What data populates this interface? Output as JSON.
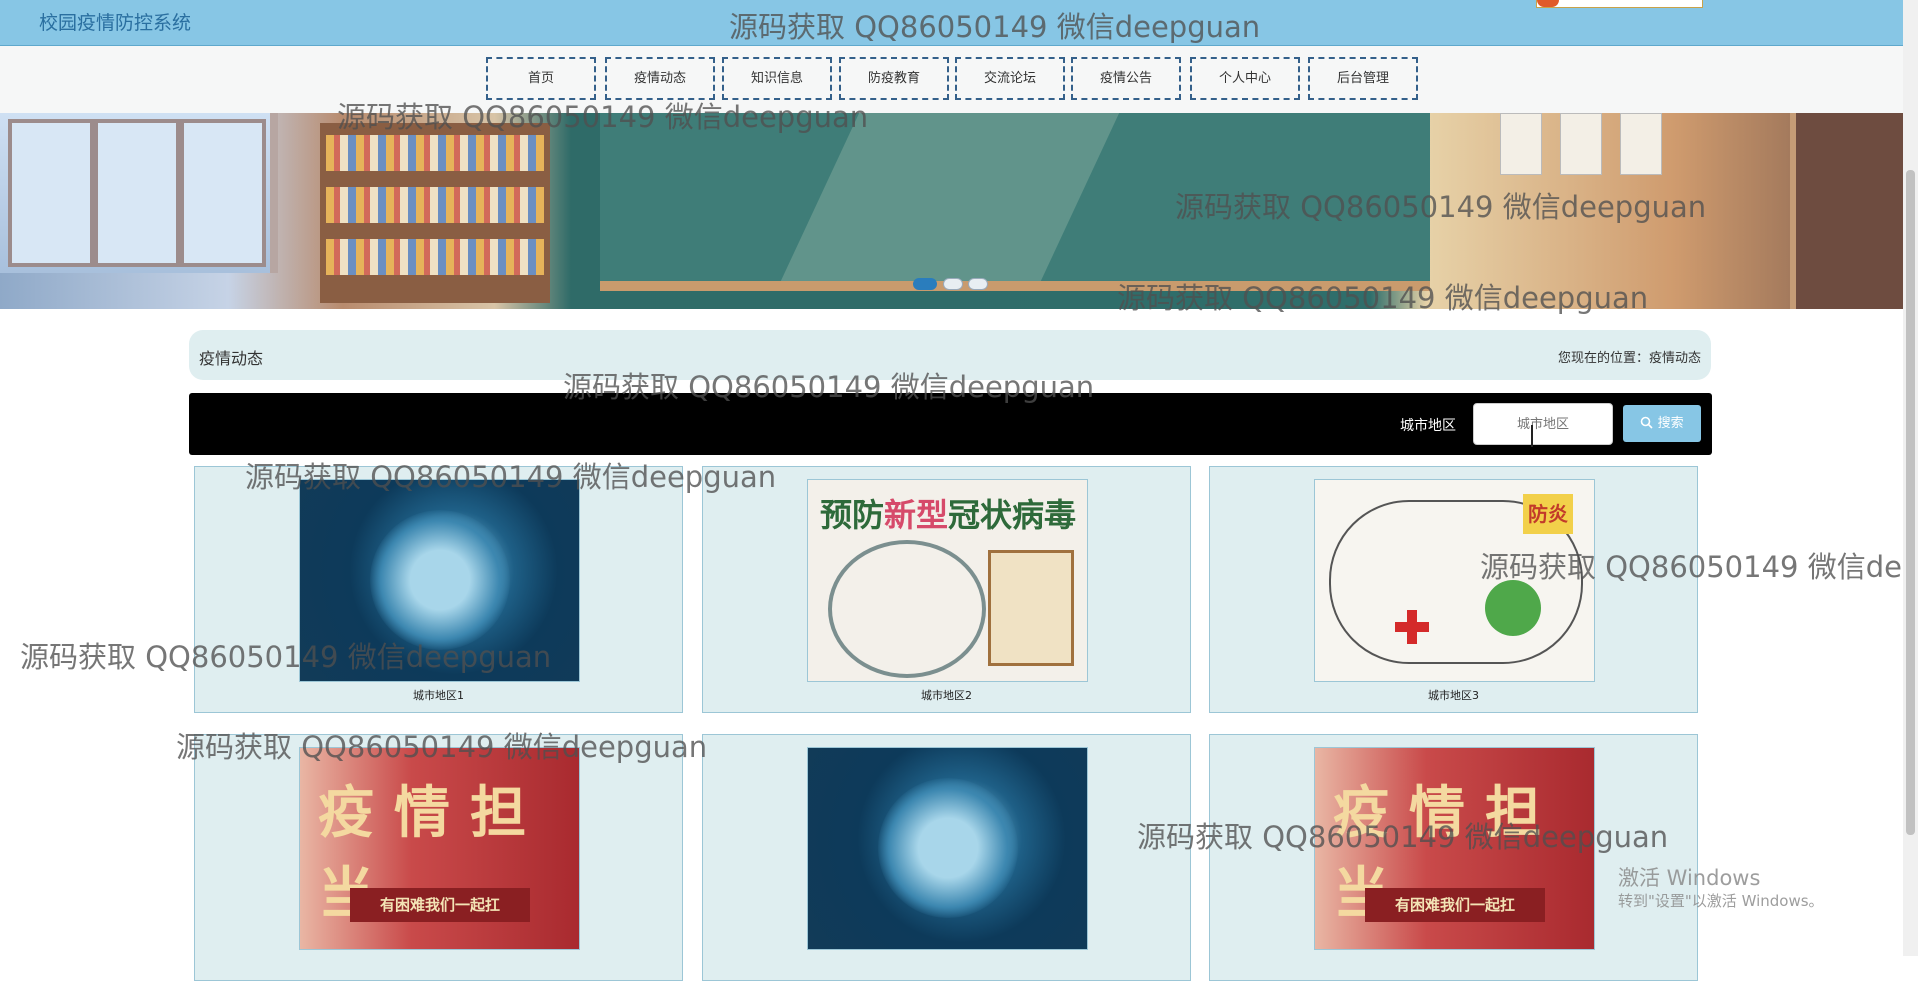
{
  "header": {
    "site_title": "校园疫情防控系统"
  },
  "nav": {
    "items": [
      {
        "label": "首页"
      },
      {
        "label": "疫情动态"
      },
      {
        "label": "知识信息"
      },
      {
        "label": "防疫教育"
      },
      {
        "label": "交流论坛"
      },
      {
        "label": "疫情公告"
      },
      {
        "label": "个人中心"
      },
      {
        "label": "后台管理"
      }
    ]
  },
  "carousel": {
    "slide_count": 3,
    "active_slide": 1
  },
  "section": {
    "title": "疫情动态",
    "location_text": "您现在的位置：疫情动态"
  },
  "search": {
    "label": "城市地区",
    "placeholder": "城市地区",
    "button_label": "搜索"
  },
  "cards": [
    {
      "caption": "城市地区1",
      "image": "virus"
    },
    {
      "caption": "城市地区2",
      "image": "poster"
    },
    {
      "caption": "城市地区3",
      "image": "drawing"
    },
    {
      "caption": "",
      "image": "campaign"
    },
    {
      "caption": "",
      "image": "virus"
    },
    {
      "caption": "",
      "image": "campaign"
    }
  ],
  "poster_text": {
    "headline_a": "预防",
    "headline_b": "新型",
    "headline_c": "冠状病毒"
  },
  "drawing_text": {
    "tag": "防炎"
  },
  "campaign_text": {
    "big": "疫情担当",
    "strip": "有困难我们一起扛"
  },
  "watermark": "源码获取 QQ86050149 微信deepguan",
  "os_notice": {
    "title": "激活 Windows",
    "subtitle": "转到\"设置\"以激活 Windows。"
  },
  "colors": {
    "topbar": "#87c6e5",
    "nav_border": "#34608a",
    "panel": "#dfeef0",
    "search_bar": "#000000"
  },
  "icons": {
    "search_button": "search-icon"
  }
}
